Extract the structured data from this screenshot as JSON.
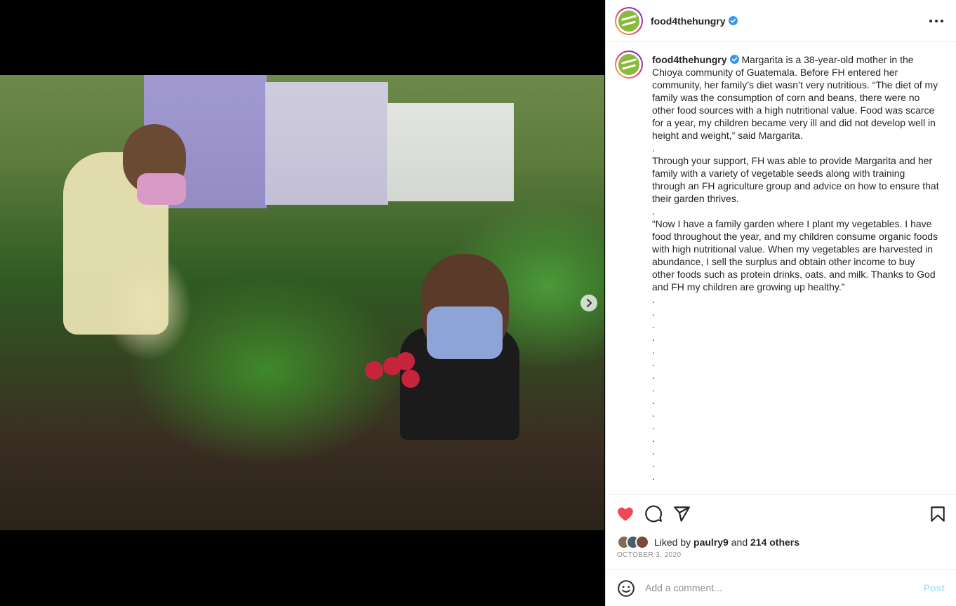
{
  "post": {
    "username": "food4thehungry",
    "verified": true
  },
  "caption": {
    "username": "food4thehungry",
    "text": "Margarita is a 38-year-old mother in the Chioya community of Guatemala. Before FH entered her community, her family’s diet wasn’t very nutritious. “The diet of my family was the consumption of corn and beans, there were no other food sources with a high nutritional value. Food was scarce for a year, my children became very ill and did not develop well in height and weight,” said Margarita.\n.\nThrough your support, FH was able to provide Margarita and her family with a variety of vegetable seeds along with training through an FH agriculture group and advice on how to ensure that their garden thrives.\n.\n“Now I have a family garden where I plant my vegetables. I have food throughout the year, and my children consume organic foods with high nutritional value. When my vegetables are harvested in abundance, I sell the surplus and obtain other income to buy other foods such as protein drinks, oats, and milk. Thanks to God and FH my children are growing up healthy.”\n.\n.\n.\n.\n.\n.\n.\n.\n.\n.\n.\n.\n.\n.\n."
  },
  "likes": {
    "prefix": "Liked by",
    "first_user": "paulry9",
    "joiner": "and",
    "others": "214 others"
  },
  "date": "OCTOBER 3, 2020",
  "comment": {
    "placeholder": "Add a comment...",
    "post_label": "Post"
  },
  "colors": {
    "like_red": "#ed4956",
    "verified_blue": "#3897f0",
    "post_disabled": "#b2dffc"
  },
  "icons": [
    "heart-icon",
    "comment-icon",
    "share-icon",
    "bookmark-icon",
    "more-icon",
    "emoji-icon",
    "next-arrow-icon",
    "verified-icon"
  ]
}
